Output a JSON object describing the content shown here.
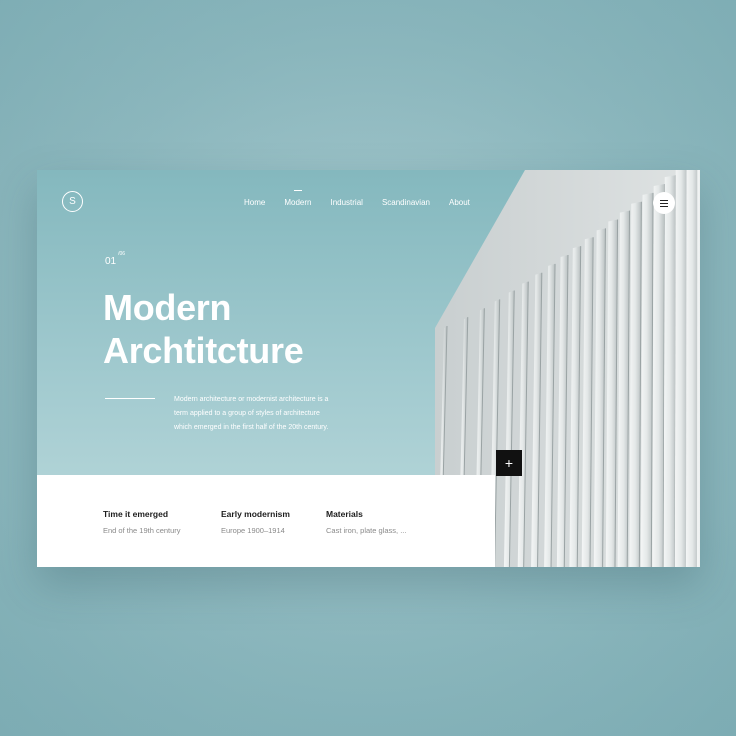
{
  "brand": {
    "logo_letter": "S"
  },
  "nav": {
    "items": [
      {
        "label": "Home"
      },
      {
        "label": "Modern",
        "active": true
      },
      {
        "label": "Industrial"
      },
      {
        "label": "Scandinavian"
      },
      {
        "label": "About"
      }
    ]
  },
  "menu": {
    "icon": "hamburger-icon"
  },
  "slide": {
    "current": "01",
    "total": "/06"
  },
  "hero": {
    "title_line1": "Modern",
    "title_line2": "Archtitcture",
    "description_line1": "Modern architecture or modernist architecture is a",
    "description_line2": "term applied to a group of styles of architecture",
    "description_line3": "which emerged in the first half of the 20th century."
  },
  "info": [
    {
      "label": "Time it emerged",
      "value": "End of the 19th century"
    },
    {
      "label": "Early modernism",
      "value": "Europe 1900–1914"
    },
    {
      "label": "Materials",
      "value": "Cast iron, plate glass, ..."
    }
  ],
  "plus_button": {
    "label": "+",
    "icon": "plus-icon"
  },
  "colors": {
    "background": "#8fb9bf",
    "sky_top": "#84b8be",
    "sky_bottom": "#bcdadc",
    "panel": "#ffffff",
    "accent_dark": "#111111"
  }
}
